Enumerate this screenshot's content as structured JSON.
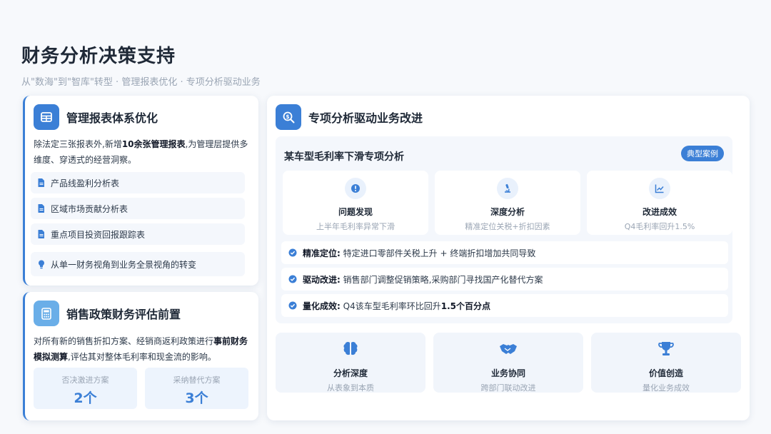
{
  "header": {
    "title": "财务分析决策支持",
    "subtitle": "从\"数海\"到\"智库\"转型 · 管理报表优化 · 专项分析驱动业务"
  },
  "report_card": {
    "icon": "table-icon",
    "title": "管理报表体系优化",
    "desc_prefix": "除法定三张报表外,新增",
    "desc_bold": "10余张管理报表",
    "desc_suffix": ",为管理层提供多维度、穿透式的经营洞察。",
    "items": [
      {
        "icon": "document-icon",
        "label": "产品线盈利分析表"
      },
      {
        "icon": "document-icon",
        "label": "区域市场贡献分析表"
      },
      {
        "icon": "document-icon",
        "label": "重点项目投资回报跟踪表"
      }
    ],
    "insight": {
      "icon": "lightbulb-icon",
      "label": "从单一财务视角到业务全景视角的转变"
    }
  },
  "policy_card": {
    "icon": "calculator-icon",
    "title": "销售政策财务评估前置",
    "desc_prefix": "对所有新的销售折扣方案、经销商返利政策进行",
    "desc_bold": "事前财务模拟测算",
    "desc_suffix": ",评估其对整体毛利率和现金流的影响。",
    "stats": [
      {
        "label": "否决激进方案",
        "value": "2个"
      },
      {
        "label": "采纳替代方案",
        "value": "3个"
      }
    ]
  },
  "analysis_card": {
    "icon": "search-dollar-icon",
    "title": "专项分析驱动业务改进",
    "case": {
      "title": "某车型毛利率下滑专项分析",
      "badge": "典型案例",
      "steps": [
        {
          "icon": "alert-icon",
          "title": "问题发现",
          "sub": "上半年毛利率异常下滑"
        },
        {
          "icon": "microscope-icon",
          "title": "深度分析",
          "sub": "精准定位关税+折扣因素"
        },
        {
          "icon": "chart-line-icon",
          "title": "改进成效",
          "sub": "Q4毛利率回升1.5%"
        }
      ],
      "findings": [
        {
          "label": "精准定位:",
          "text": "特定进口零部件关税上升 + 终端折扣增加共同导致"
        },
        {
          "label": "驱动改进:",
          "text": "销售部门调整促销策略,采购部门寻找国产化替代方案"
        },
        {
          "label": "量化成效:",
          "text_prefix": "Q4该车型毛利率环比回升",
          "text_bold": "1.5个百分点"
        }
      ]
    },
    "values": [
      {
        "icon": "brain-icon",
        "title": "分析深度",
        "sub": "从表象到本质"
      },
      {
        "icon": "handshake-icon",
        "title": "业务协同",
        "sub": "跨部门联动改进"
      },
      {
        "icon": "trophy-icon",
        "title": "价值创造",
        "sub": "量化业务成效"
      }
    ]
  },
  "colors": {
    "accent": "#3b7fd6",
    "accent_light": "#6aaee8",
    "panel": "#f4f7fc"
  }
}
